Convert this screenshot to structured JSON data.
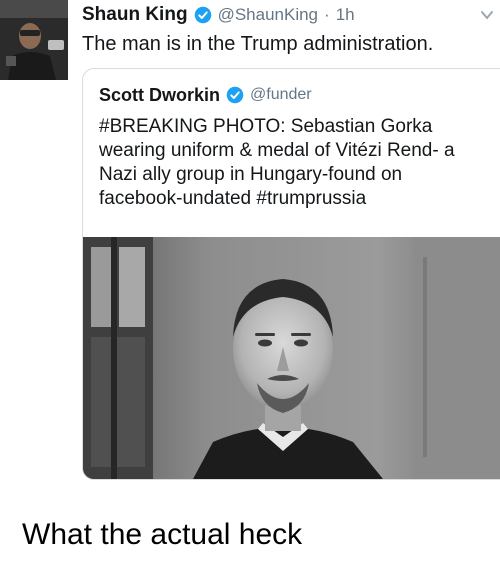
{
  "tweet": {
    "author_name": "Shaun King",
    "author_handle": "@ShaunKing",
    "time_sep": "·",
    "time": "1h",
    "text": "The man is in the Trump administration.",
    "avatar_icon": "profile-avatar",
    "verified_icon": "verified-badge-icon",
    "verified_color": "#1da1f2"
  },
  "quoted_tweet": {
    "author_name": "Scott Dworkin",
    "author_handle": "@funder",
    "text": "#BREAKING PHOTO: Sebastian Gorka wearing uniform & medal of Vitézi Rend- a Nazi ally group in Hungary-found on facebook-undated #trumprussia",
    "photo_icon": "black-and-white-portrait-photo"
  },
  "caption": {
    "text": "What the actual heck"
  }
}
